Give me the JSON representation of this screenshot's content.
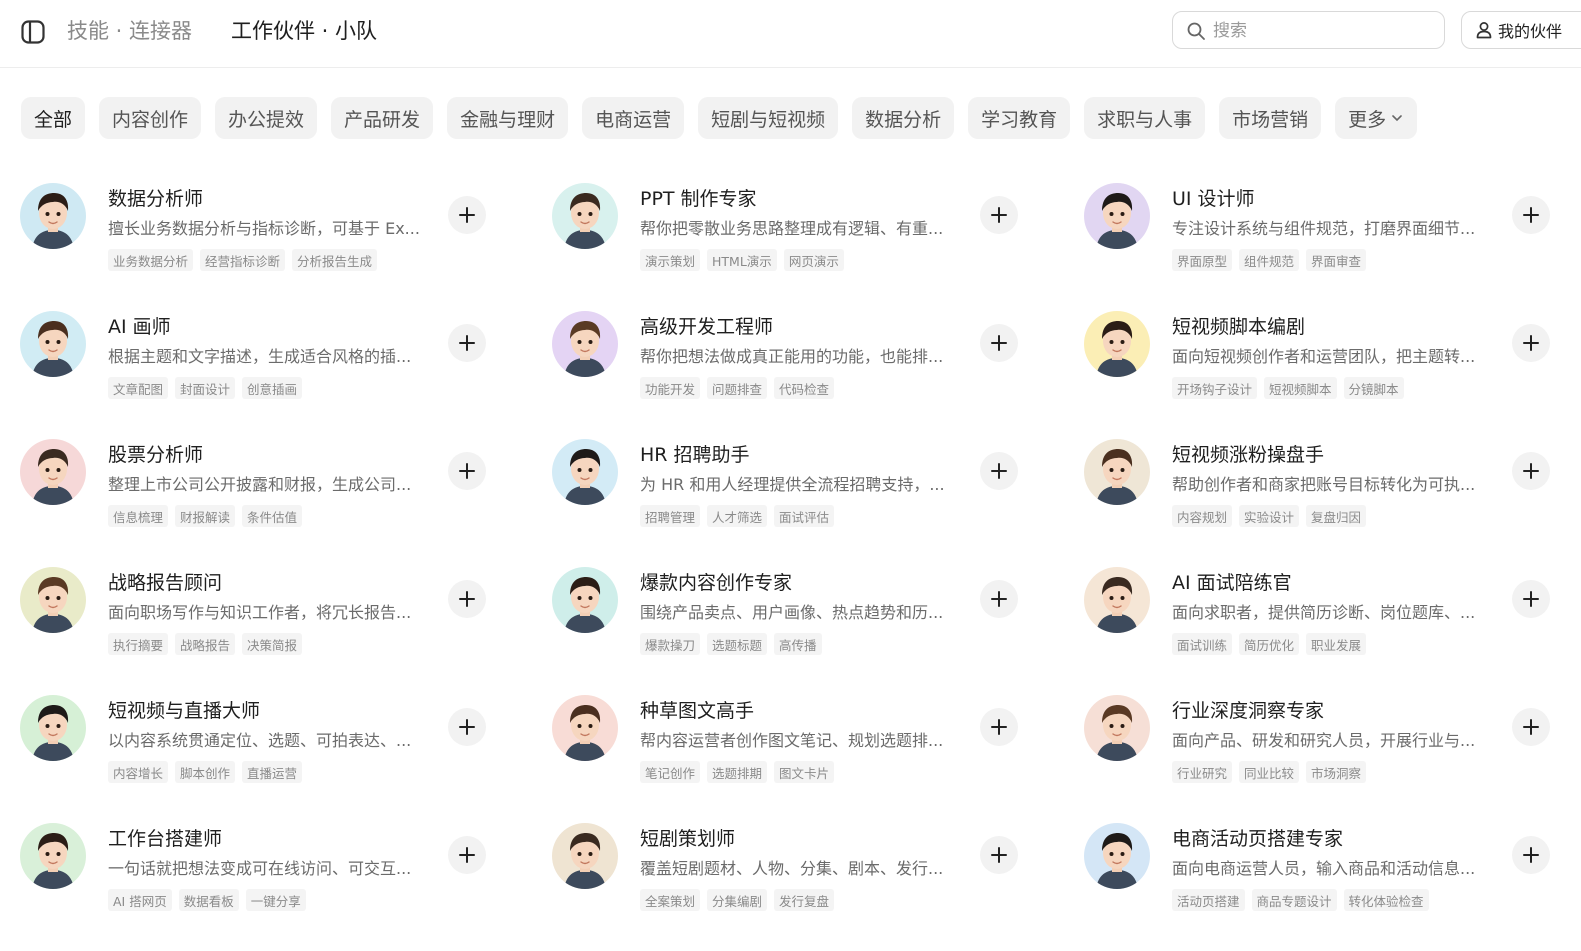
{
  "header": {
    "breadcrumb": "技能 · 连接器",
    "current": "工作伙伴 · 小队",
    "search_placeholder": "搜索",
    "partner_button": "我的伙伴"
  },
  "tabs": [
    {
      "label": "全部",
      "active": true
    },
    {
      "label": "内容创作"
    },
    {
      "label": "办公提效"
    },
    {
      "label": "产品研发"
    },
    {
      "label": "金融与理财"
    },
    {
      "label": "电商运营"
    },
    {
      "label": "短剧与短视频"
    },
    {
      "label": "数据分析"
    },
    {
      "label": "学习教育"
    },
    {
      "label": "求职与人事"
    },
    {
      "label": "市场营销"
    },
    {
      "label": "更多",
      "has_chevron": true
    }
  ],
  "colors": {
    "accent_bg": "#f2f2f2",
    "text_primary": "#1f1f1f",
    "text_secondary": "#6b6b6b"
  },
  "agents": [
    {
      "name": "数据分析师",
      "desc": "擅长业务数据分析与指标诊断，可基于 Ex...",
      "tags": [
        "业务数据分析",
        "经营指标诊断",
        "分析报告生成"
      ],
      "avatar_bg": "#cfe9f3"
    },
    {
      "name": "PPT 制作专家",
      "desc": "帮你把零散业务思路整理成有逻辑、有重...",
      "tags": [
        "演示策划",
        "HTML演示",
        "网页演示"
      ],
      "avatar_bg": "#d8f1ee"
    },
    {
      "name": "UI 设计师",
      "desc": "专注设计系统与组件规范，打磨界面细节...",
      "tags": [
        "界面原型",
        "组件规范",
        "界面审查"
      ],
      "avatar_bg": "#e1d6f2"
    },
    {
      "name": "AI 画师",
      "desc": "根据主题和文字描述，生成适合风格的插...",
      "tags": [
        "文章配图",
        "封面设计",
        "创意插画"
      ],
      "avatar_bg": "#d1ecf4"
    },
    {
      "name": "高级开发工程师",
      "desc": "帮你把想法做成真正能用的功能，也能排...",
      "tags": [
        "功能开发",
        "问题排查",
        "代码检查"
      ],
      "avatar_bg": "#e4d4f4"
    },
    {
      "name": "短视频脚本编剧",
      "desc": "面向短视频创作者和运营团队，把主题转...",
      "tags": [
        "开场钩子设计",
        "短视频脚本",
        "分镜脚本"
      ],
      "avatar_bg": "#fbeeb5"
    },
    {
      "name": "股票分析师",
      "desc": "整理上市公司公开披露和财报，生成公司...",
      "tags": [
        "信息梳理",
        "财报解读",
        "条件估值"
      ],
      "avatar_bg": "#f6d8d8"
    },
    {
      "name": "HR 招聘助手",
      "desc": "为 HR 和用人经理提供全流程招聘支持，...",
      "tags": [
        "招聘管理",
        "人才筛选",
        "面试评估"
      ],
      "avatar_bg": "#d3ebf6"
    },
    {
      "name": "短视频涨粉操盘手",
      "desc": "帮助创作者和商家把账号目标转化为可执...",
      "tags": [
        "内容规划",
        "实验设计",
        "复盘归因"
      ],
      "avatar_bg": "#efe6d6"
    },
    {
      "name": "战略报告顾问",
      "desc": "面向职场写作与知识工作者，将冗长报告...",
      "tags": [
        "执行摘要",
        "战略报告",
        "决策简报"
      ],
      "avatar_bg": "#e9ebc9"
    },
    {
      "name": "爆款内容创作专家",
      "desc": "围绕产品卖点、用户画像、热点趋势和历...",
      "tags": [
        "爆款操刀",
        "选题标题",
        "高传播"
      ],
      "avatar_bg": "#cfeeea"
    },
    {
      "name": "AI 面试陪练官",
      "desc": "面向求职者，提供简历诊断、岗位题库、...",
      "tags": [
        "面试训练",
        "简历优化",
        "职业发展"
      ],
      "avatar_bg": "#f5e6d6"
    },
    {
      "name": "短视频与直播大师",
      "desc": "以内容系统贯通定位、选题、可拍表达、...",
      "tags": [
        "内容增长",
        "脚本创作",
        "直播运营"
      ],
      "avatar_bg": "#d6f0d6"
    },
    {
      "name": "种草图文高手",
      "desc": "帮内容运营者创作图文笔记、规划选题排...",
      "tags": [
        "笔记创作",
        "选题排期",
        "图文卡片"
      ],
      "avatar_bg": "#f8dcd6"
    },
    {
      "name": "行业深度洞察专家",
      "desc": "面向产品、研发和研究人员，开展行业与...",
      "tags": [
        "行业研究",
        "同业比较",
        "市场洞察"
      ],
      "avatar_bg": "#f6dfd6"
    },
    {
      "name": "工作台搭建师",
      "desc": "一句话就把想法变成可在线访问、可交互...",
      "tags": [
        "AI 搭网页",
        "数据看板",
        "一键分享"
      ],
      "avatar_bg": "#d9f0d9"
    },
    {
      "name": "短剧策划师",
      "desc": "覆盖短剧题材、人物、分集、剧本、发行...",
      "tags": [
        "全案策划",
        "分集编剧",
        "发行复盘"
      ],
      "avatar_bg": "#efe4d2"
    },
    {
      "name": "电商活动页搭建专家",
      "desc": "面向电商运营人员，输入商品和活动信息...",
      "tags": [
        "活动页搭建",
        "商品专题设计",
        "转化体验检查"
      ],
      "avatar_bg": "#d4e6f6"
    }
  ]
}
